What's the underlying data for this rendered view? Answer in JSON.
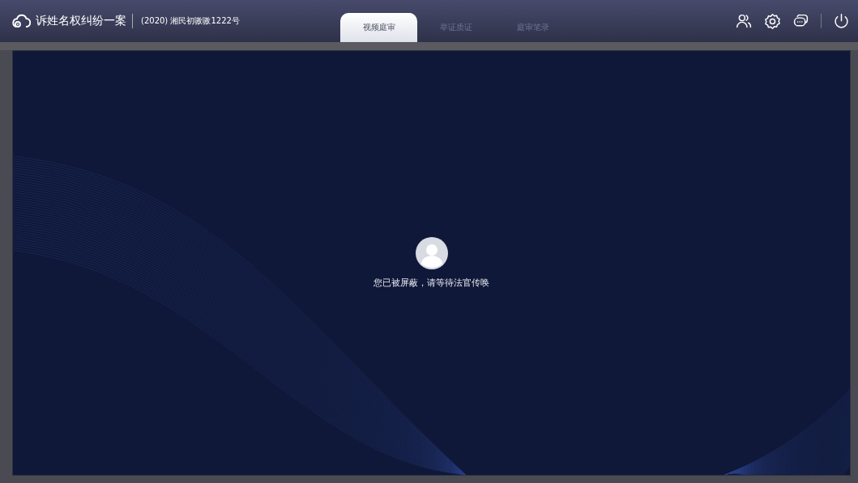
{
  "header": {
    "case_title": "诉姓名权纠纷一案",
    "case_number": "(2020) 湘民初嗷嗷1222号"
  },
  "tabs": [
    {
      "label": "视频庭审",
      "selected": true
    },
    {
      "label": "举证质证",
      "selected": false
    },
    {
      "label": "庭审笔录",
      "selected": false
    }
  ],
  "toolbar": [
    {
      "kind": "people"
    },
    {
      "kind": "settings"
    },
    {
      "kind": "chat"
    },
    {
      "kind": "power"
    }
  ],
  "stage": {
    "message": "您已被屏蔽，请等待法官传唤"
  }
}
